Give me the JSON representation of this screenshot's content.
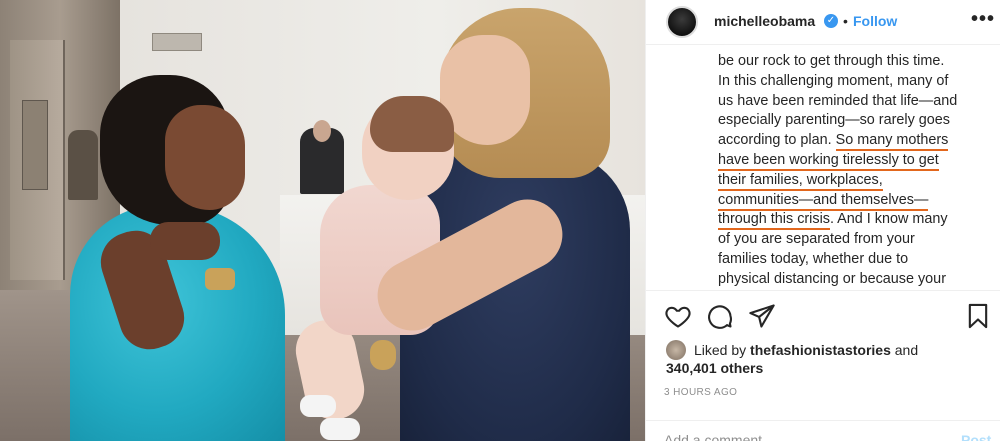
{
  "post": {
    "photo_label": "photo",
    "header": {
      "username": "michelleobama",
      "separator": "•",
      "follow_label": "Follow",
      "more_icon": "more-options-icon",
      "verified_icon": "verified-badge-icon"
    },
    "caption_lines": [
      {
        "plain": "be our rock to get through this time.",
        "underlined": ""
      },
      {
        "plain": "In this challenging moment, many of",
        "underlined": ""
      },
      {
        "plain": "us have been reminded that life—and",
        "underlined": ""
      },
      {
        "plain": "especially parenting—so rarely goes",
        "underlined": ""
      },
      {
        "plain": "according to plan. ",
        "underlined": "So many mothers"
      },
      {
        "plain": "",
        "underlined": "have been working tirelessly to get"
      },
      {
        "plain": "",
        "underlined": "their families, workplaces,"
      },
      {
        "plain": "",
        "underlined": "communities—and themselves—"
      },
      {
        "plain": "",
        "underlined": "through this crisis",
        "after": ". And I know many"
      },
      {
        "plain": "of you are separated from your",
        "underlined": ""
      },
      {
        "plain": "families today, whether due to",
        "underlined": ""
      },
      {
        "plain": "physical distancing or because your",
        "underlined": ""
      }
    ],
    "actions": {
      "like_icon": "heart-icon",
      "comment_icon": "comment-icon",
      "share_icon": "share-icon",
      "save_icon": "bookmark-icon"
    },
    "likes": {
      "prefix": "Liked by",
      "user": "thefashionistastories",
      "and": "and",
      "count": "340,401 others"
    },
    "time": "3 HOURS AGO",
    "comment_placeholder": "Add a comment...",
    "post_label": "Post",
    "accent_colors": {
      "link": "#3897f0",
      "underline": "#e2671d",
      "muted": "#8e8e8e"
    }
  }
}
